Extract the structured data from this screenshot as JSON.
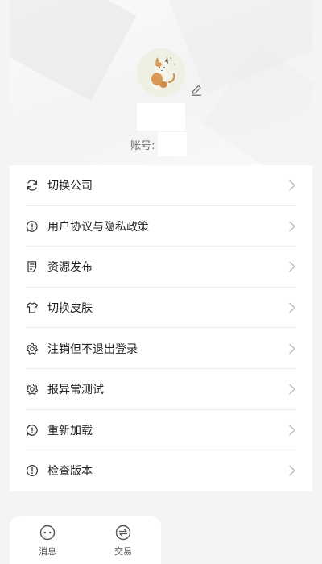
{
  "profile": {
    "avatar_icon": "cat-avatar",
    "edit_icon": "pencil-icon",
    "account_label": "账号:"
  },
  "menu": {
    "items": [
      {
        "label": "切换公司",
        "icon": "refresh-icon"
      },
      {
        "label": "用户协议与隐私政策",
        "icon": "speech-info-icon"
      },
      {
        "label": "资源发布",
        "icon": "document-icon"
      },
      {
        "label": "切换皮肤",
        "icon": "shirt-icon"
      },
      {
        "label": "注销但不退出登录",
        "icon": "gear-icon"
      },
      {
        "label": "报异常测试",
        "icon": "gear-icon"
      },
      {
        "label": "重新加载",
        "icon": "speech-info-icon"
      },
      {
        "label": "检查版本",
        "icon": "alert-circle-icon"
      }
    ]
  },
  "tabbar": {
    "tabs": [
      {
        "label": "消息",
        "icon": "chat-bubble-icon"
      },
      {
        "label": "交易",
        "icon": "exchange-icon"
      }
    ]
  },
  "colors": {
    "background": "#f4f4f5",
    "card": "#ffffff",
    "text": "#1f1f1f",
    "divider": "#eeeeee",
    "chevron": "#bbbbbb"
  }
}
